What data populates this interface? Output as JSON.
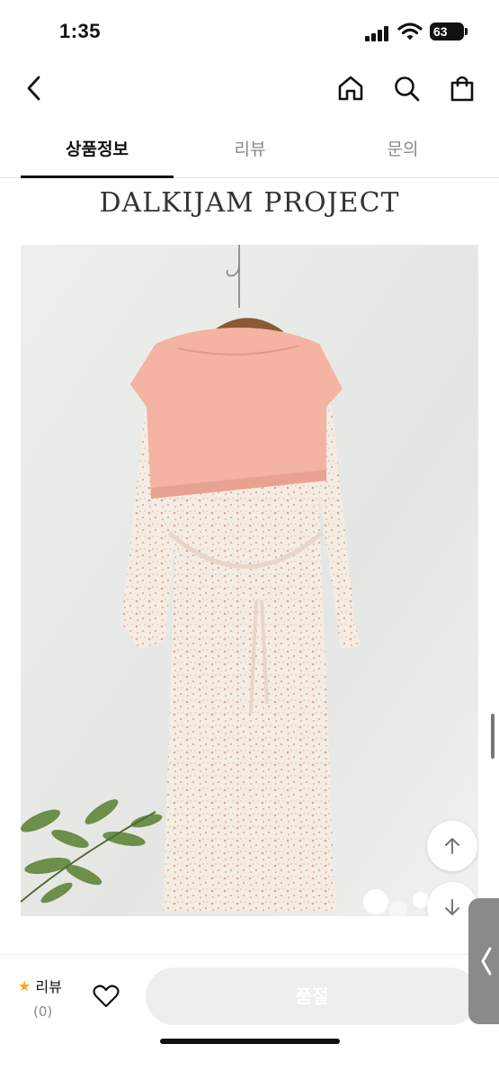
{
  "status": {
    "time": "1:35",
    "battery": "63"
  },
  "nav": {
    "icons": [
      "back-chevron-icon",
      "home-icon",
      "search-icon",
      "shopping-bag-icon"
    ]
  },
  "tabs": [
    {
      "label": "상품정보",
      "active": true
    },
    {
      "label": "리뷰",
      "active": false
    },
    {
      "label": "문의",
      "active": false
    }
  ],
  "brand": "DALKIJAM PROJECT",
  "product_image": {
    "subject": "pink knit cape over floral long dress on wooden hanger"
  },
  "bottom": {
    "review_label": "리뷰",
    "review_count": "(0)",
    "soldout_label": "품절"
  },
  "colors": {
    "accent": "#111111",
    "star": "#f5a623",
    "soldout_bg": "#eeeeee",
    "tab_inactive": "#888888"
  }
}
